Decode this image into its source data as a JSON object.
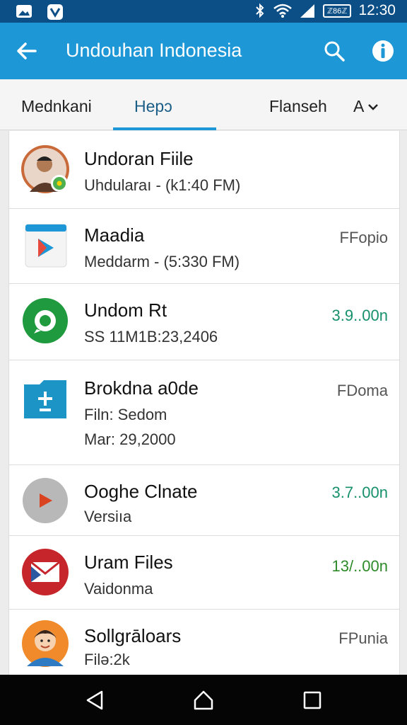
{
  "status_bar": {
    "time": "12:30",
    "battery": "ℤ86ℤ",
    "icons": [
      "gallery-icon",
      "shield-app-icon",
      "bluetooth-icon",
      "wifi-icon",
      "signal-icon",
      "battery-icon"
    ]
  },
  "app_bar": {
    "title": "Undouhan Indonesia",
    "icons": [
      "back-arrow-icon",
      "search-icon",
      "info-icon"
    ]
  },
  "tabs": {
    "items": [
      {
        "label": "Mednkani",
        "active": false
      },
      {
        "label": "Hepɔ",
        "active": true
      },
      {
        "label": "Flanseh",
        "active": false
      }
    ],
    "more_label": "A",
    "more_icon": "chevron-down-icon"
  },
  "files": [
    {
      "name": "Undoran Fiile",
      "sub1": "Uhdularaı - (k1:40 FM)",
      "sub2": "",
      "right": "",
      "icon": "profile-photo-icon"
    },
    {
      "name": "Maadia",
      "sub1": "Meddarm - (5:330 FM)",
      "sub2": "",
      "right": "FFopio",
      "icon": "play-store-icon"
    },
    {
      "name": "Undom Rt",
      "sub1": "SS 11M1B:23,2406",
      "sub2": "",
      "right": "3.9..00n",
      "icon": "green-chat-icon"
    },
    {
      "name": "Brokdna a0de",
      "sub1": "Filn: Sedom",
      "sub2": "Mar: 29,2000",
      "right": "FDoma",
      "icon": "upload-folder-icon"
    },
    {
      "name": "Ooghe Clnate",
      "sub1": "Versiıa",
      "sub2": "",
      "right": "3.7..00n",
      "icon": "play-circle-icon"
    },
    {
      "name": "Uram Files",
      "sub1": "Vaidonma",
      "sub2": "",
      "right": "13/..00n",
      "icon": "mail-icon"
    },
    {
      "name": "Sollgrāloars",
      "sub1": "Filə:2k",
      "sub2": "",
      "right": "FPunia",
      "icon": "cartoon-avatar-icon"
    }
  ],
  "colors": {
    "status_bar": "#0c4f87",
    "app_bar": "#1d97d6",
    "tab_indicator": "#1d97d6",
    "version_green": "#17906c",
    "nav_bar": "#050505"
  }
}
